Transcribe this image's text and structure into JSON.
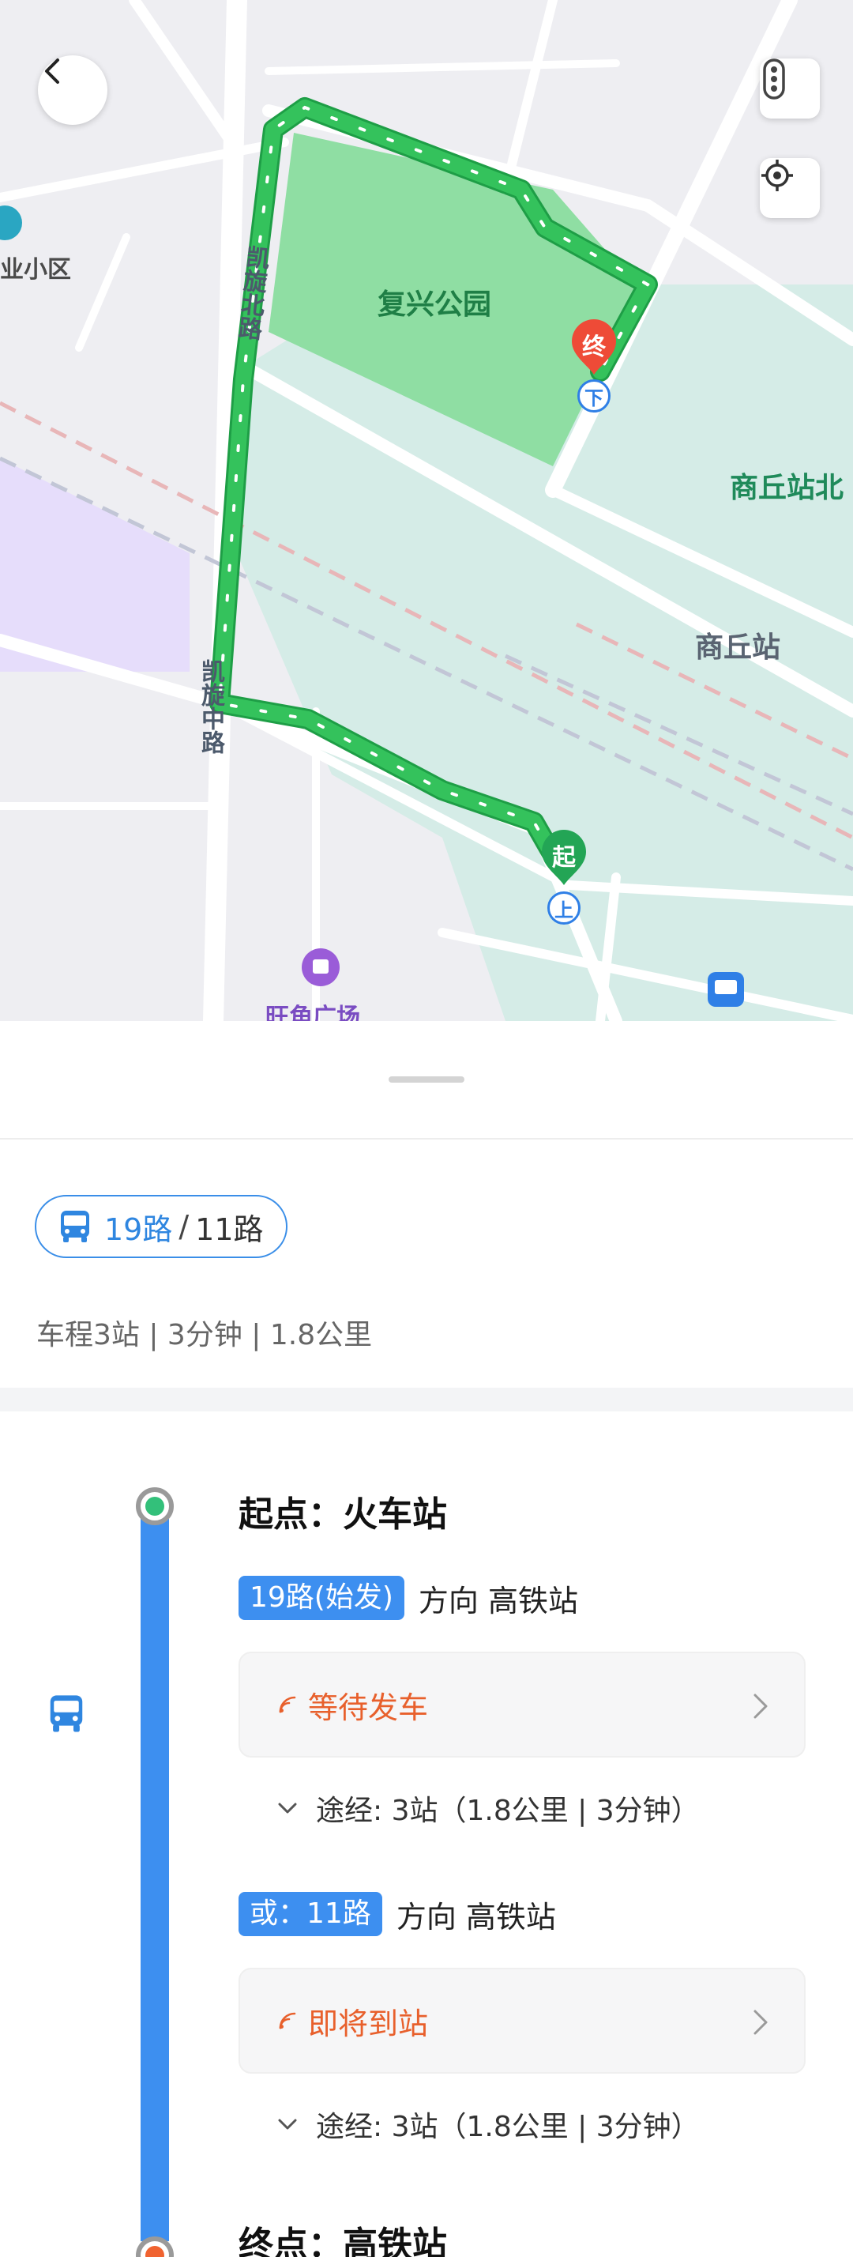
{
  "map": {
    "labels": {
      "park": "复兴公园",
      "road_north": "凯旋北路",
      "road_middle": "凯旋中路",
      "district_partial": "业小区",
      "station_north_partial": "商丘站北",
      "station": "商丘站",
      "plaza": "旺角广场"
    },
    "markers": {
      "start": "起",
      "end": "终",
      "board": "上",
      "alight": "下"
    },
    "colors": {
      "route": "#34c25c",
      "park": "#8fdea3",
      "station_area": "#d5ece7",
      "start_marker": "#23a555",
      "end_marker": "#ee4b37"
    },
    "icons": {
      "back": "back-arrow-icon",
      "traffic": "traffic-light-icon",
      "locate": "locate-icon"
    }
  },
  "sheet": {
    "route_chip": {
      "primary": "19路",
      "separator": "/",
      "secondary": "11路"
    },
    "summary": "车程3站 | 3分钟 | 1.8公里",
    "timeline": {
      "start_label": "起点：火车站",
      "end_label": "终点：高铁站",
      "options": [
        {
          "tag": "19路(始发)",
          "direction": "方向 高铁站",
          "status": "等待发车",
          "via": "途经: 3站（1.8公里 | 3分钟）"
        },
        {
          "tag": "或：11路",
          "direction": "方向 高铁站",
          "status": "即将到站",
          "via": "途经: 3站（1.8公里 | 3分钟）"
        }
      ]
    },
    "colors": {
      "accent": "#3d8ff0",
      "status": "#e8602c",
      "start_dot": "#33c07a",
      "end_dot": "#f06330"
    }
  }
}
